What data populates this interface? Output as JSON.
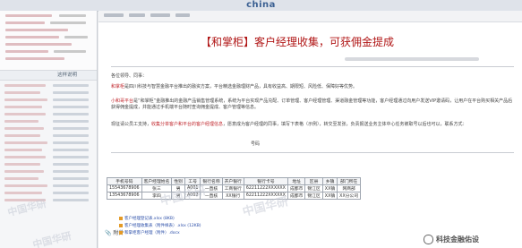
{
  "header": {
    "brand": "china"
  },
  "sidebar": {
    "section_label": "这样说明",
    "list_label": "这样说明",
    "watermark": "中国华研"
  },
  "message": {
    "title": "【和掌柜】客户经理收集，可获佣金提成",
    "greeting": "各位领导、同事：",
    "para1_prefix": "和掌柜",
    "para1_text": "是四川科技与智慧金融平台推出的融资方案，平台精选金融理财产品，具有收益高、期限短、风险低、保障好等优势。",
    "para2_red": "小和哥平台",
    "para2_text": "是“和掌柜”金融推出的金融产品销售管理系统，系统为平台实现产品兑配、订单管理、客户经理管理、渠道融金管理等功能，客户经理通过向用户发送VIP邀请码，让用户在平台购买相关产品后获得佣金提成，并能通过手机端平台随时查询佣金提成、客户管理等信息。",
    "para3_prefix": "现征请公员工支持，",
    "para3_link": "收集分单客户和平台的客户经理信息",
    "para3_suffix": "，愿意成为客户经理的同事，填写下表格（示例），转交至发张，负责报送业务主体中心",
    "para3_tail": "任务被取号以后也可以，联系方式：",
    "sign": "号码"
  },
  "table": {
    "headers": [
      "手机号码",
      "客户经理姓名",
      "性别",
      "工号",
      "银行名称",
      "开户银行",
      "银行卡号",
      "地址",
      "区县",
      "乡镇",
      "部门所在"
    ],
    "rows": [
      [
        "15543678906",
        "张三",
        "男",
        "A001",
        "一直核",
        "工商银行",
        "62211222XXXXXX",
        "成都市",
        "锦江区",
        "XX镇",
        "网商部"
      ],
      [
        "13543678906",
        "李四",
        "男",
        "A002",
        "一直核",
        "XX银行",
        "62211222XXXXXX",
        "成都市",
        "锦江区",
        "XX镇",
        "XX分公司"
      ]
    ]
  },
  "attachments": {
    "label": "附件",
    "items": [
      "客户经理登记表.xlsx (8KB)",
      "客户经理收集表（附件样表）.xlsx (12KB)",
      "和掌柜客户经理（附件）.docx"
    ]
  },
  "badge": {
    "text": "科技金融佑设"
  }
}
